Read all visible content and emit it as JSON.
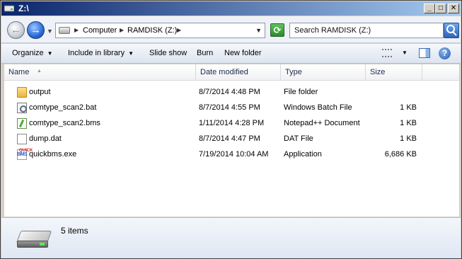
{
  "window": {
    "title": "Z:\\"
  },
  "title_buttons": {
    "minimize": "_",
    "maximize": "□",
    "close": "✕"
  },
  "navigation": {
    "breadcrumbs": [
      "Computer",
      "RAMDISK (Z:)"
    ],
    "search_placeholder": "Search RAMDISK (Z:)"
  },
  "commands": {
    "organize": "Organize",
    "include_in_library": "Include in library",
    "slide_show": "Slide show",
    "burn": "Burn",
    "new_folder": "New folder",
    "help": "?"
  },
  "columns": {
    "name": "Name",
    "date_modified": "Date modified",
    "type": "Type",
    "size": "Size"
  },
  "files": [
    {
      "name": "output",
      "date": "8/7/2014 4:48 PM",
      "type": "File folder",
      "size": "",
      "icon": "folder-icon"
    },
    {
      "name": "comtype_scan2.bat",
      "date": "8/7/2014 4:55 PM",
      "type": "Windows Batch File",
      "size": "1 KB",
      "icon": "batch-file-icon"
    },
    {
      "name": "comtype_scan2.bms",
      "date": "1/11/2014 4:28 PM",
      "type": "Notepad++ Document",
      "size": "1 KB",
      "icon": "notepadpp-file-icon"
    },
    {
      "name": "dump.dat",
      "date": "8/7/2014 4:47 PM",
      "type": "DAT File",
      "size": "1 KB",
      "icon": "generic-file-icon"
    },
    {
      "name": "quickbms.exe",
      "date": "7/19/2014 10:04 AM",
      "type": "Application",
      "size": "6,686 KB",
      "icon": "quickbms-app-icon"
    }
  ],
  "details_pane": {
    "item_count": "5 items"
  }
}
